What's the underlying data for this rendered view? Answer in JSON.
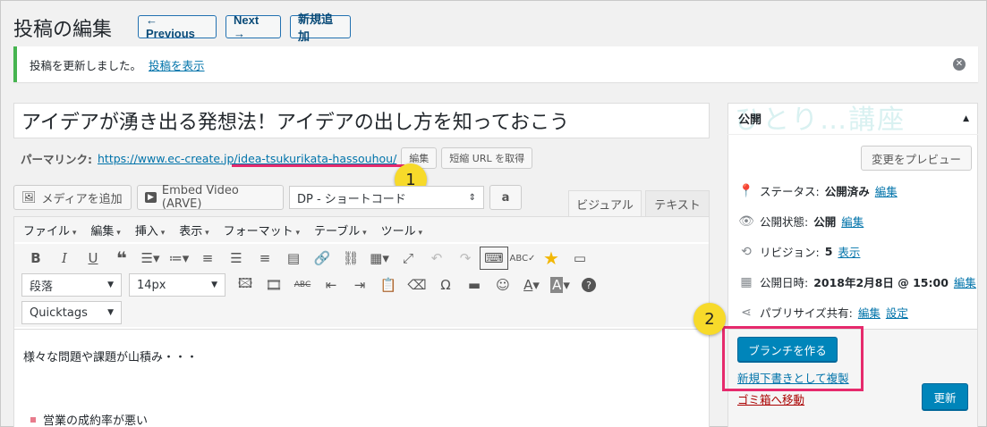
{
  "header": {
    "title": "投稿の編集",
    "prev_label": "← Previous",
    "next_label": "Next →",
    "new_label": "新規追加"
  },
  "notice": {
    "message": "投稿を更新しました。",
    "link": "投稿を表示",
    "close_icon": "close-circle-icon"
  },
  "post": {
    "title": "アイデアが湧き出る発想法！アイデアの出し方を知っておこう",
    "permalink_label": "パーマリンク:",
    "permalink_base": "https://www.ec-create.jp/",
    "permalink_slug": "idea-tsukurikata-hassouhou/",
    "edit_label": "編集",
    "shortlink_label": "短縮 URL を取得"
  },
  "annotations": {
    "badge1": "1",
    "badge2": "2",
    "highlight_color": "#e62a6c"
  },
  "media": {
    "add_media": "メディアを追加",
    "embed_video": "Embed Video (ARVE)",
    "shortcode_select": "DP - ショートコード",
    "amazon_icon": "a"
  },
  "editor_tabs": {
    "visual": "ビジュアル",
    "text": "テキスト"
  },
  "menubar": [
    "ファイル",
    "編集",
    "挿入",
    "表示",
    "フォーマット",
    "テーブル",
    "ツール"
  ],
  "toolbar": {
    "format_select": "段落",
    "size_select": "14px",
    "quicktags_select": "Quicktags"
  },
  "content": {
    "paragraph": "様々な問題や課題が山積み・・・",
    "bullet1": "営業の成約率が悪い"
  },
  "sidebar": {
    "title": "公開",
    "watermark": "ひとり…講座",
    "preview_label": "変更をプレビュー",
    "status_label": "ステータス:",
    "status_value": "公開済み",
    "visibility_label": "公開状態:",
    "visibility_value": "公開",
    "revisions_label": "リビジョン:",
    "revisions_value": "5",
    "revisions_link": "表示",
    "date_label": "公開日時:",
    "date_value": "2018年2月8日 @ 15:00",
    "publicize_label": "パブリサイズ共有:",
    "edit_link": "編集",
    "settings_link": "設定",
    "branch_button": "ブランチを作る",
    "copy_draft": "新規下書きとして複製",
    "trash": "ゴミ箱へ移動",
    "update_button": "更新"
  }
}
